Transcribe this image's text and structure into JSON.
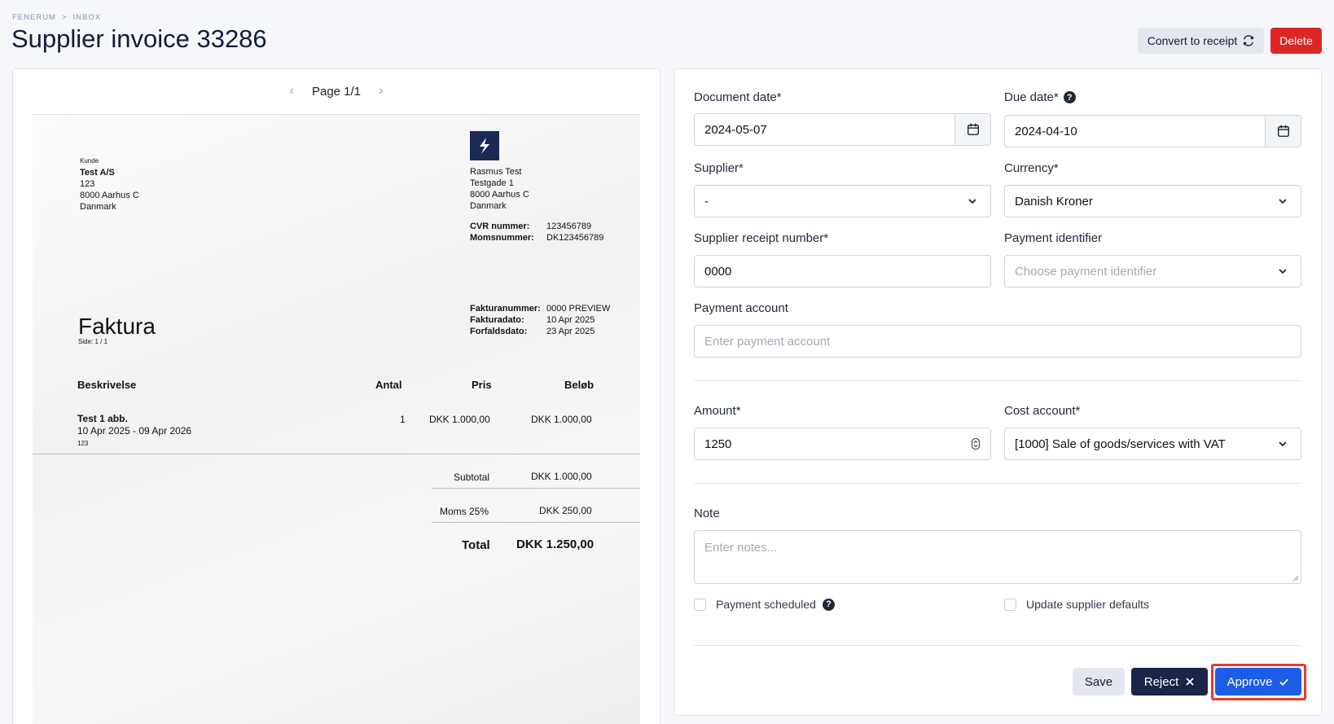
{
  "breadcrumb": {
    "root": "FENERUM",
    "separator": ">",
    "current": "INBOX"
  },
  "title": "Supplier invoice 33286",
  "header_actions": {
    "convert_label": "Convert to receipt",
    "delete_label": "Delete"
  },
  "viewer": {
    "page_label": "Page 1/1"
  },
  "invoice": {
    "customer_caption": "Kunde",
    "customer": [
      "Test A/S",
      "123",
      "8000 Aarhus C",
      "Danmark"
    ],
    "sender": [
      "Rasmus Test",
      "Testgade 1",
      "8000 Aarhus C",
      "Danmark"
    ],
    "cvr_label": "CVR nummer:",
    "cvr_value": "123456789",
    "vat_label": "Momsnummer:",
    "vat_value": "DK123456789",
    "number_label": "Fakturanummer:",
    "number_value": "0000 PREVIEW",
    "date_label": "Fakturadato:",
    "date_value": "10 Apr 2025",
    "due_label": "Forfaldsdato:",
    "due_value": "23 Apr 2025",
    "heading": "Faktura",
    "page_note": "Side: 1 / 1",
    "columns": [
      "Beskrivelse",
      "Antal",
      "Pris",
      "Beløb"
    ],
    "line": {
      "desc": "Test 1 abb.",
      "period": "10 Apr 2025 - 09 Apr 2026",
      "ref": "123",
      "qty": "1",
      "price": "DKK 1.000,00",
      "amount": "DKK 1.000,00"
    },
    "subtotal_label": "Subtotal",
    "subtotal_value": "DKK 1.000,00",
    "moms_label": "Moms 25%",
    "moms_value": "DKK 250,00",
    "total_label": "Total",
    "total_value": "DKK 1.250,00"
  },
  "form": {
    "document_date": {
      "label": "Document date*",
      "value": "2024-05-07"
    },
    "due_date": {
      "label": "Due date*",
      "value": "2024-04-10"
    },
    "supplier": {
      "label": "Supplier*",
      "value": "-"
    },
    "currency": {
      "label": "Currency*",
      "value": "Danish Kroner"
    },
    "supplier_receipt_number": {
      "label": "Supplier receipt number*",
      "value": "0000"
    },
    "payment_identifier": {
      "label": "Payment identifier",
      "placeholder": "Choose payment identifier"
    },
    "payment_account": {
      "label": "Payment account",
      "placeholder": "Enter payment account"
    },
    "amount": {
      "label": "Amount*",
      "value": "1250"
    },
    "cost_account": {
      "label": "Cost account*",
      "value": "[1000] Sale of goods/services with VAT"
    },
    "note": {
      "label": "Note",
      "placeholder": "Enter notes..."
    },
    "payment_scheduled_label": "Payment scheduled",
    "update_supplier_defaults_label": "Update supplier defaults"
  },
  "footer_actions": {
    "save_label": "Save",
    "reject_label": "Reject",
    "approve_label": "Approve"
  },
  "colors": {
    "primary": "#1d5ce6",
    "danger": "#dc2626",
    "dark": "#1b2547",
    "highlight": "#e8392b"
  }
}
